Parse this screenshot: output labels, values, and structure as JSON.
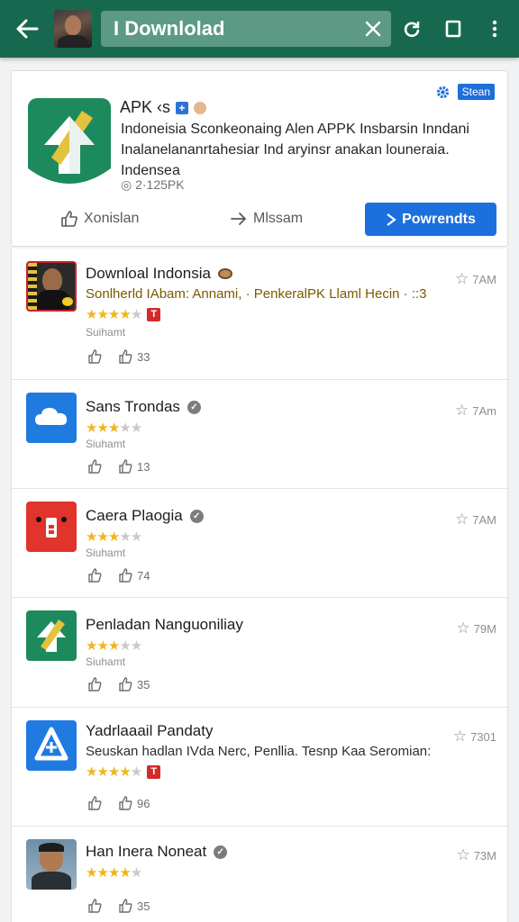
{
  "toolbar": {
    "search_value": "I Downlolad"
  },
  "featured": {
    "title": "APK ‹s",
    "settings_label": "Stean",
    "description": "Indoneisia Sconkeonaing Alen APPK Insbarsin Inndani Inalanelananrtahesiar Ind aryinsr anakan louneraia. Indensea",
    "size": "◎ 2·125PK",
    "action1": "Xonislan",
    "action2": "Mlssam",
    "download_label": "Powrendts"
  },
  "apps": [
    {
      "name": "Downloal Indonsia",
      "subtitle": "Sonlherld IAbam: Annami, · PenkeralPK Llaml Hecin · ::3",
      "stars": 4,
      "badge": "T",
      "meta": "Suihamt",
      "time": "7AM",
      "likes": "33",
      "icon": "photo-icon"
    },
    {
      "name": "Sans Trondas",
      "subtitle": "",
      "stars": 3,
      "badge": "",
      "meta": "Siuhamt",
      "time": "7Am",
      "likes": "13",
      "icon": "cloud-icon"
    },
    {
      "name": "Caera Plaogia",
      "subtitle": "",
      "stars": 3,
      "badge": "",
      "meta": "Siuhamt",
      "time": "7AM",
      "likes": "74",
      "icon": "alert-icon"
    },
    {
      "name": "Penladan Nanguoniliay",
      "subtitle": "",
      "stars": 3,
      "badge": "",
      "meta": "Siuhamt",
      "time": "79M",
      "likes": "35",
      "icon": "arrow-up-icon"
    },
    {
      "name": "Yadrlaaail Pandaty",
      "subtitle": "Seuskan hadlan IVda Nerc, Penllia. Tesnp Kaa Seromian:",
      "stars": 4,
      "badge": "T",
      "meta": "",
      "time": "7301",
      "likes": "96",
      "icon": "triangle-icon"
    },
    {
      "name": "Han Inera Noneat",
      "subtitle": "",
      "stars": 4,
      "badge": "",
      "meta": "",
      "time": "73M",
      "likes": "35",
      "icon": "person-photo-icon"
    }
  ],
  "colors": {
    "topbar": "#16694f",
    "accent": "#1c70de",
    "star": "#f1b51c"
  }
}
